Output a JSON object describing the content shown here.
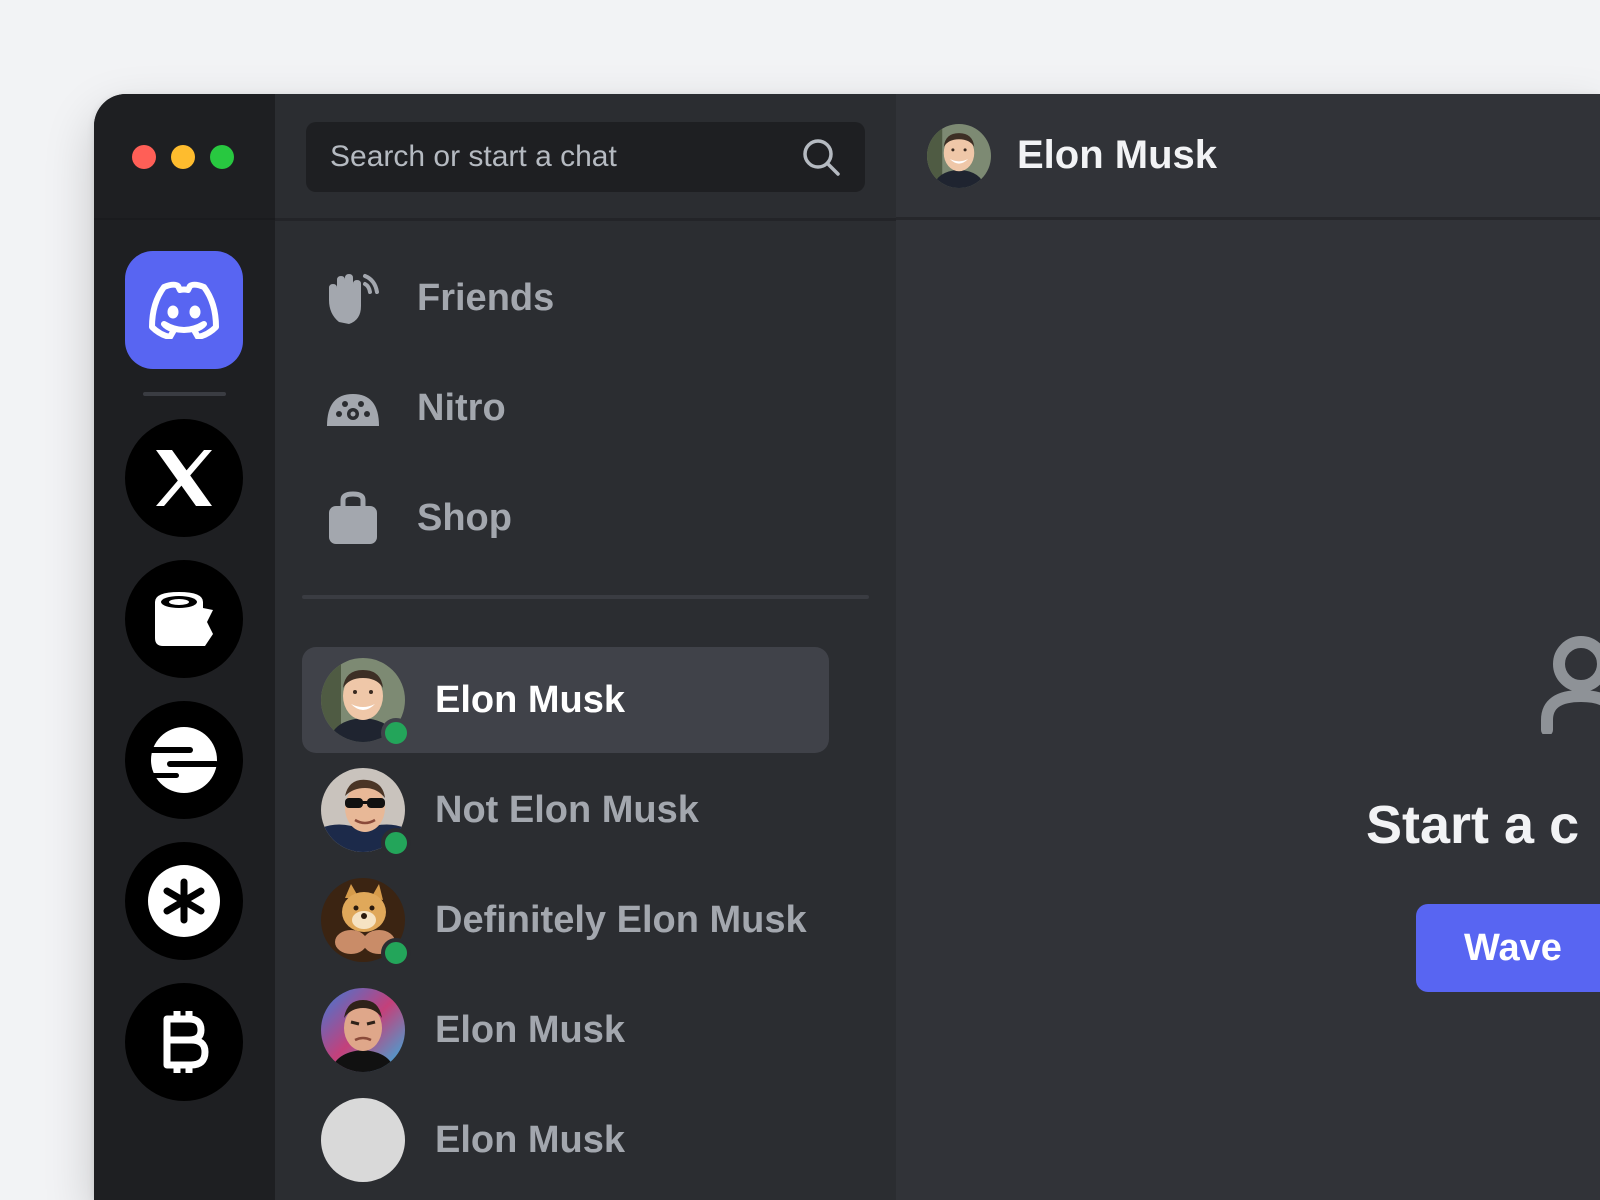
{
  "window": {
    "controls": [
      "close",
      "minimize",
      "zoom"
    ]
  },
  "rail": {
    "servers": [
      {
        "name": "discord-home",
        "icon": "discord-icon"
      },
      {
        "name": "x",
        "icon": "x-logo-icon"
      },
      {
        "name": "tape",
        "icon": "tape-roll-icon"
      },
      {
        "name": "speed",
        "icon": "speed-lines-icon"
      },
      {
        "name": "asterisk",
        "icon": "asterisk-icon"
      },
      {
        "name": "bitcoin",
        "icon": "bitcoin-icon"
      }
    ]
  },
  "search": {
    "placeholder": "Search or start a chat",
    "icon": "search-icon"
  },
  "nav": {
    "friends": {
      "label": "Friends",
      "icon": "waving-hand-icon"
    },
    "nitro": {
      "label": "Nitro",
      "icon": "nitro-gauge-icon"
    },
    "shop": {
      "label": "Shop",
      "icon": "shopping-bag-icon"
    }
  },
  "dms": [
    {
      "name": "Elon Musk",
      "online": true,
      "active": true
    },
    {
      "name": "Not Elon Musk",
      "online": true,
      "active": false
    },
    {
      "name": "Definitely Elon Musk",
      "online": true,
      "active": false
    },
    {
      "name": "Elon Musk",
      "online": false,
      "active": false
    },
    {
      "name": "Elon Musk",
      "online": false,
      "active": false
    }
  ],
  "main": {
    "header_title": "Elon Musk",
    "start_text": "Start a c",
    "wave_button": "Wave"
  },
  "colors": {
    "accent": "#5865f2",
    "online": "#23a55a",
    "rail_bg": "#1e1f22",
    "sidebar_bg": "#2b2d31",
    "main_bg": "#313338"
  }
}
